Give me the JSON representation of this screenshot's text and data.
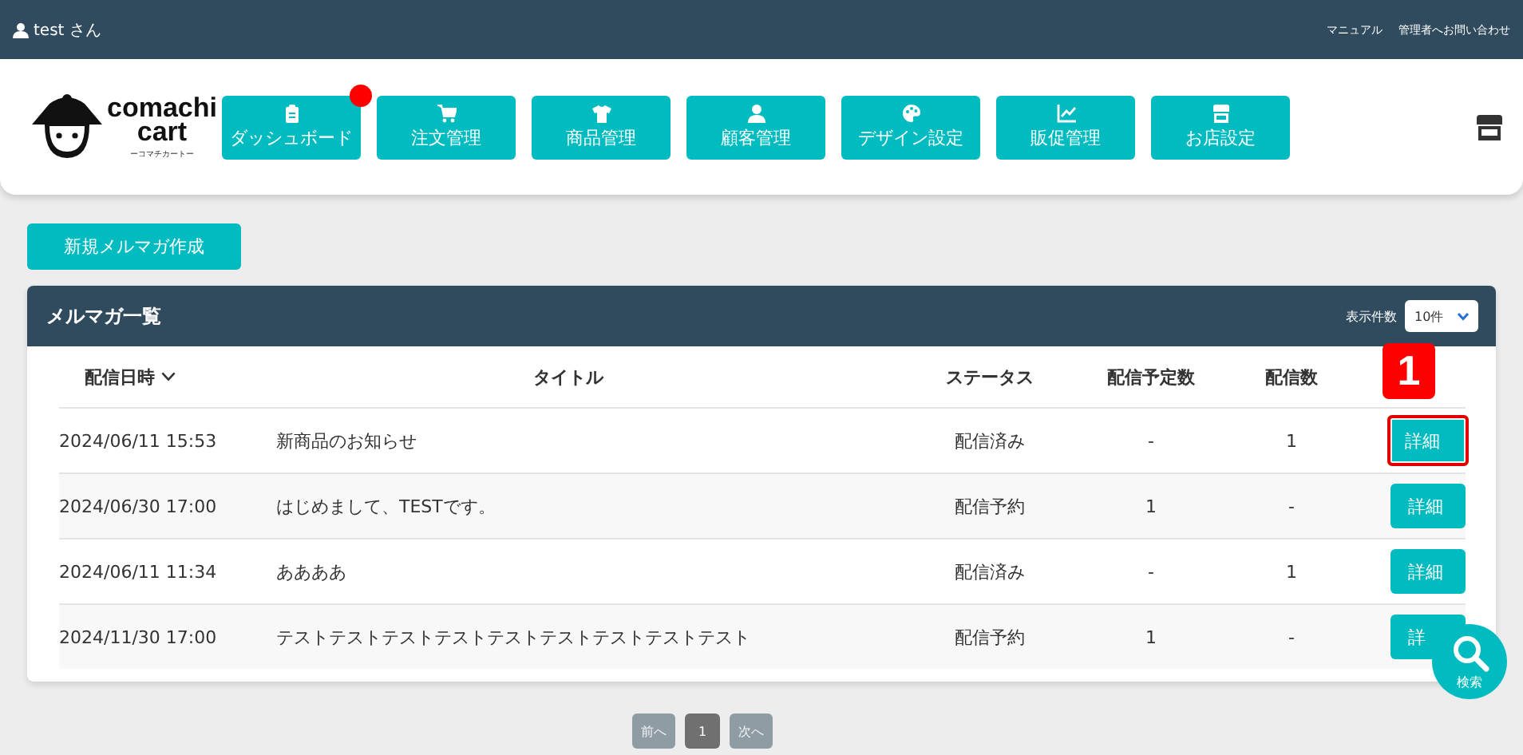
{
  "top_bar": {
    "user": "test さん",
    "links": [
      "マニュアル",
      "管理者へお問い合わせ"
    ]
  },
  "nav": {
    "logo": {
      "name": "comachi\ncart",
      "tagline": "ーコマチカートー"
    },
    "items": [
      {
        "label": "ダッシュボード",
        "notification": true
      },
      {
        "label": "注文管理",
        "notification": false
      },
      {
        "label": "商品管理",
        "notification": false
      },
      {
        "label": "顧客管理",
        "notification": false
      },
      {
        "label": "デザイン設定",
        "notification": false
      },
      {
        "label": "販促管理",
        "notification": false
      },
      {
        "label": "お店設定",
        "notification": false
      }
    ]
  },
  "create_button": "新規メルマガ作成",
  "panel": {
    "title": "メルマガ一覧",
    "page_size_label": "表示件数",
    "page_size": "10件",
    "columns": [
      {
        "label": "配信日時",
        "sorted": true
      },
      {
        "label": "タイトル",
        "sorted": false
      },
      {
        "label": "ステータス",
        "sorted": false
      },
      {
        "label": "配信予定数",
        "sorted": false
      },
      {
        "label": "配信数",
        "sorted": false
      }
    ],
    "callout": "1",
    "rows": [
      {
        "date": "2024/06/11 15:53",
        "title": "新商品のお知らせ",
        "status": "配信済み",
        "planned": "-",
        "sent": "1",
        "button": "詳細",
        "highlighted": true
      },
      {
        "date": "2024/06/30 17:00",
        "title": "はじめまして、TESTです。",
        "status": "配信予約",
        "planned": "1",
        "sent": "-",
        "button": "詳細",
        "highlighted": false
      },
      {
        "date": "2024/06/11 11:34",
        "title": "ああああ",
        "status": "配信済み",
        "planned": "-",
        "sent": "1",
        "button": "詳細",
        "highlighted": false
      },
      {
        "date": "2024/11/30 17:00",
        "title": "テストテストテストテストテストテストテストテストテスト",
        "status": "配信予約",
        "planned": "1",
        "sent": "-",
        "button": "詳",
        "highlighted": false
      }
    ]
  },
  "pagination": [
    {
      "label": "前へ",
      "disabled": true,
      "selected": false
    },
    {
      "label": "1",
      "disabled": false,
      "selected": true
    },
    {
      "label": "次へ",
      "disabled": true,
      "selected": false
    }
  ],
  "search_fab": "検索"
}
